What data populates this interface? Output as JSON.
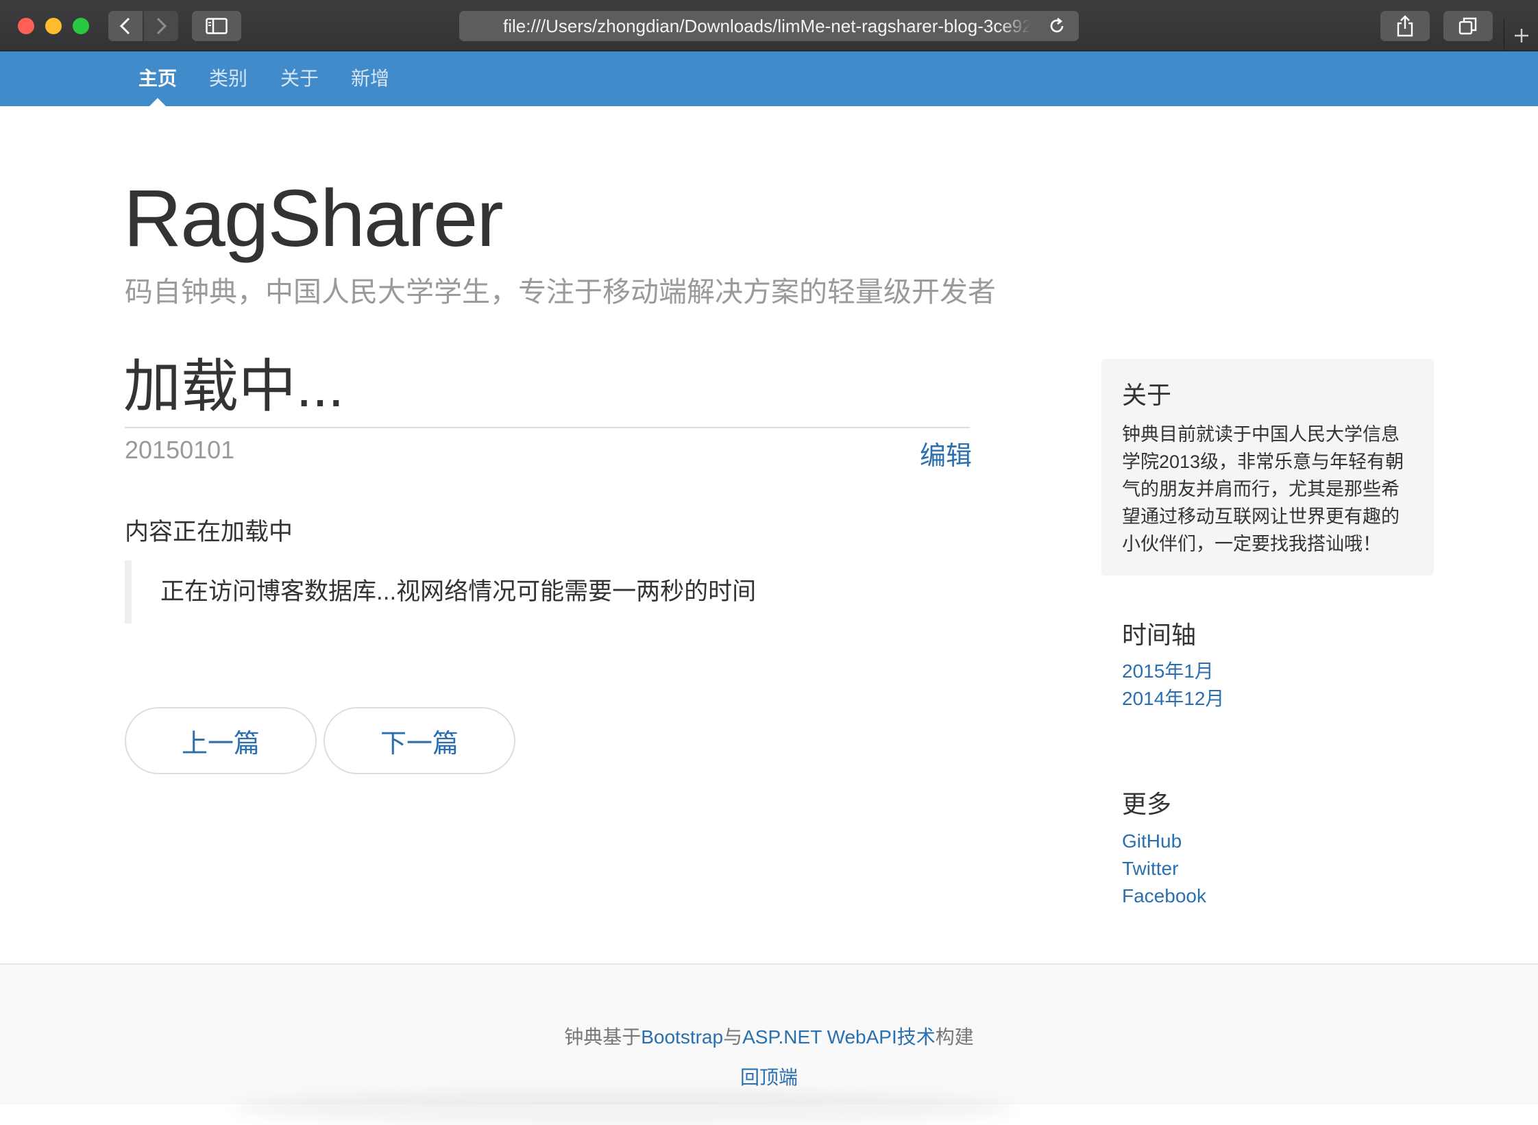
{
  "browser": {
    "url": "file:///Users/zhongdian/Downloads/limMe-net-ragsharer-blog-3ce92"
  },
  "nav": {
    "items": [
      {
        "label": "主页",
        "active": true
      },
      {
        "label": "类别",
        "active": false
      },
      {
        "label": "关于",
        "active": false
      },
      {
        "label": "新增",
        "active": false
      }
    ]
  },
  "header": {
    "brand": "RagSharer",
    "tagline": "码自钟典，中国人民大学学生，专注于移动端解决方案的轻量级开发者"
  },
  "post": {
    "title": "加载中...",
    "date": "20150101",
    "edit_label": "编辑",
    "body": "内容正在加载中",
    "quote": "正在访问博客数据库...视网络情况可能需要一两秒的时间",
    "prev_label": "上一篇",
    "next_label": "下一篇"
  },
  "sidebar": {
    "about": {
      "heading": "关于",
      "text": "钟典目前就读于中国人民大学信息学院2013级，非常乐意与年轻有朝气的朋友并肩而行，尤其是那些希望通过移动互联网让世界更有趣的小伙伴们，一定要找我搭讪哦！"
    },
    "timeline": {
      "heading": "时间轴",
      "items": [
        "2015年1月",
        "2014年12月"
      ]
    },
    "more": {
      "heading": "更多",
      "items": [
        "GitHub",
        "Twitter",
        "Facebook"
      ]
    }
  },
  "footer": {
    "prefix": "钟典基于",
    "link1": "Bootstrap",
    "middle": "与",
    "link2": "ASP.NET WebAPI技术",
    "suffix": "构建",
    "back_to_top": "回顶端"
  },
  "colors": {
    "nav_bg": "#428bca",
    "link": "#2a6fb0",
    "chrome_bg": "#38383a"
  }
}
